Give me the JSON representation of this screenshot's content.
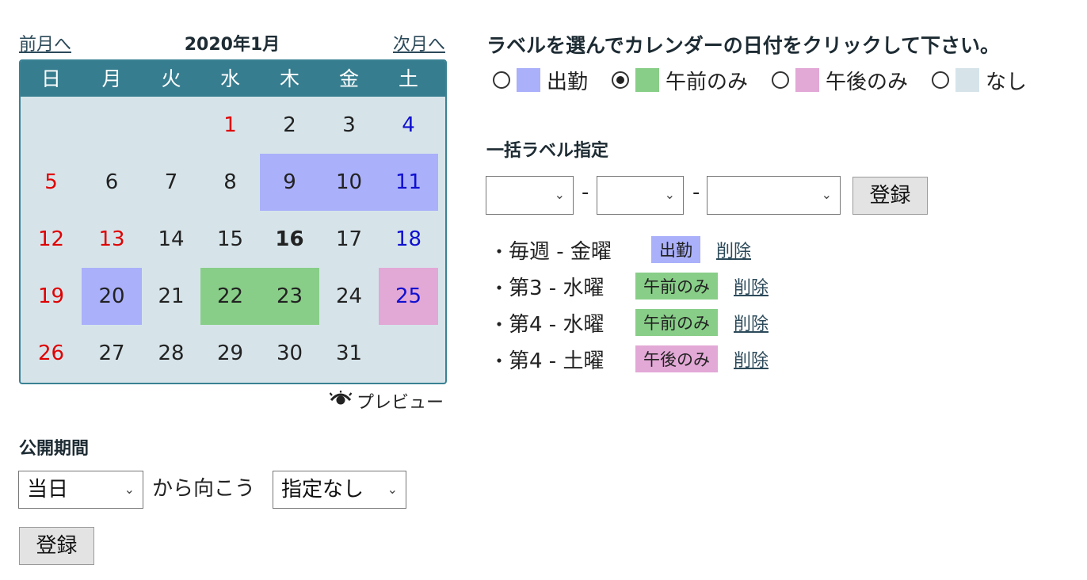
{
  "calendar": {
    "prev_label": "前月へ",
    "title": "2020年1月",
    "next_label": "次月へ",
    "weekdays": [
      "日",
      "月",
      "火",
      "水",
      "木",
      "金",
      "土"
    ],
    "weeks": [
      [
        {
          "d": ""
        },
        {
          "d": ""
        },
        {
          "d": ""
        },
        {
          "d": "1",
          "cls": "hol"
        },
        {
          "d": "2"
        },
        {
          "d": "3"
        },
        {
          "d": "4",
          "cls": "sat"
        }
      ],
      [
        {
          "d": "5",
          "cls": "sun"
        },
        {
          "d": "6"
        },
        {
          "d": "7"
        },
        {
          "d": "8"
        },
        {
          "d": "9",
          "label": "work"
        },
        {
          "d": "10",
          "label": "work"
        },
        {
          "d": "11",
          "cls": "sat",
          "label": "work"
        }
      ],
      [
        {
          "d": "12",
          "cls": "sun"
        },
        {
          "d": "13",
          "cls": "hol"
        },
        {
          "d": "14"
        },
        {
          "d": "15"
        },
        {
          "d": "16",
          "cls": "today"
        },
        {
          "d": "17"
        },
        {
          "d": "18",
          "cls": "sat"
        }
      ],
      [
        {
          "d": "19",
          "cls": "sun"
        },
        {
          "d": "20",
          "label": "work"
        },
        {
          "d": "21"
        },
        {
          "d": "22",
          "label": "am"
        },
        {
          "d": "23",
          "label": "am"
        },
        {
          "d": "24"
        },
        {
          "d": "25",
          "cls": "sat",
          "label": "pm"
        }
      ],
      [
        {
          "d": "26",
          "cls": "sun"
        },
        {
          "d": "27"
        },
        {
          "d": "28"
        },
        {
          "d": "29"
        },
        {
          "d": "30"
        },
        {
          "d": "31"
        },
        {
          "d": ""
        }
      ]
    ],
    "preview_label": "プレビュー"
  },
  "publish": {
    "title": "公開期間",
    "from_value": "当日",
    "middle_text": "から向こう",
    "to_value": "指定なし",
    "submit_label": "登録"
  },
  "instruction": "ラベルを選んでカレンダーの日付をクリックして下さい。",
  "labels": [
    {
      "name": "出勤",
      "color": "#aab0fa",
      "checked": false
    },
    {
      "name": "午前のみ",
      "color": "#88ce88",
      "checked": true
    },
    {
      "name": "午後のみ",
      "color": "#e2a8d6",
      "checked": false
    },
    {
      "name": "なし",
      "color": "#d6e4ea",
      "checked": false
    }
  ],
  "bulk": {
    "title": "一括ラベル指定",
    "select1_value": "",
    "select2_value": "",
    "select3_value": "",
    "dash": "-",
    "submit_label": "登録"
  },
  "rules": [
    {
      "bullet": "・",
      "desc": "毎週 - 金曜",
      "tag": "出勤",
      "tag_color": "#aab0fa",
      "delete_label": "削除"
    },
    {
      "bullet": "・",
      "desc": "第3 - 水曜",
      "tag": "午前のみ",
      "tag_color": "#88ce88",
      "delete_label": "削除"
    },
    {
      "bullet": "・",
      "desc": "第4 - 水曜",
      "tag": "午前のみ",
      "tag_color": "#88ce88",
      "delete_label": "削除"
    },
    {
      "bullet": "・",
      "desc": "第4 - 土曜",
      "tag": "午後のみ",
      "tag_color": "#e2a8d6",
      "delete_label": "削除"
    }
  ],
  "colors": {
    "header_bg": "#367d8f",
    "calendar_bg": "#d6e4ea",
    "sunday_holiday": "#e00000",
    "saturday": "#1010d0"
  }
}
